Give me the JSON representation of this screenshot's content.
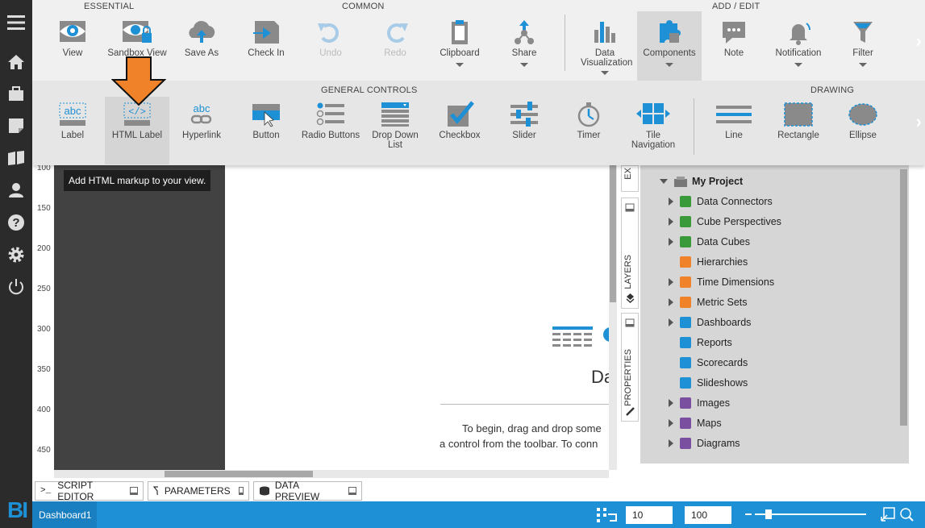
{
  "ribbon": {
    "groups": {
      "essential": "ESSENTIAL",
      "common": "COMMON",
      "add_edit": "ADD / EDIT",
      "general_controls": "GENERAL CONTROLS",
      "drawing": "DRAWING"
    },
    "buttons": {
      "view": "View",
      "sandbox_view": "Sandbox View",
      "save_as": "Save As",
      "check_in": "Check In",
      "undo": "Undo",
      "redo": "Redo",
      "clipboard": "Clipboard",
      "share": "Share",
      "data_visualization": "Data Visualization",
      "components": "Components",
      "note": "Note",
      "notification": "Notification",
      "filter": "Filter"
    },
    "controls": {
      "label": "Label",
      "html_label": "HTML Label",
      "hyperlink": "Hyperlink",
      "button": "Button",
      "radio_buttons": "Radio Buttons",
      "drop_down_list": "Drop Down List",
      "checkbox": "Checkbox",
      "slider": "Slider",
      "timer": "Timer",
      "tile_navigation": "Tile Navigation",
      "line": "Line",
      "rectangle": "Rectangle",
      "ellipse": "Ellipse"
    }
  },
  "tooltip": "Add HTML markup to your view.",
  "ruler": [
    "100",
    "150",
    "200",
    "250",
    "300",
    "350",
    "400",
    "450"
  ],
  "canvas": {
    "heading_partial": "Da",
    "hint_line1": "To begin, drag and drop some",
    "hint_line2": "a control from the toolbar. To conn"
  },
  "side_tabs": {
    "layers": "LAYERS",
    "properties": "PROPERTIES",
    "explorer": "EX"
  },
  "tree": {
    "root": "My Project",
    "items": [
      {
        "label": "Data Connectors",
        "expandable": true,
        "color": "#3a9a3a"
      },
      {
        "label": "Cube Perspectives",
        "expandable": true,
        "color": "#3a9a3a"
      },
      {
        "label": "Data Cubes",
        "expandable": true,
        "color": "#3a9a3a"
      },
      {
        "label": "Hierarchies",
        "expandable": false,
        "color": "#f0822a"
      },
      {
        "label": "Time Dimensions",
        "expandable": true,
        "color": "#f0822a"
      },
      {
        "label": "Metric Sets",
        "expandable": true,
        "color": "#f0822a"
      },
      {
        "label": "Dashboards",
        "expandable": true,
        "color": "#1e90d6"
      },
      {
        "label": "Reports",
        "expandable": false,
        "color": "#1e90d6"
      },
      {
        "label": "Scorecards",
        "expandable": false,
        "color": "#1e90d6"
      },
      {
        "label": "Slideshows",
        "expandable": false,
        "color": "#1e90d6"
      },
      {
        "label": "Images",
        "expandable": true,
        "color": "#7a4fa0"
      },
      {
        "label": "Maps",
        "expandable": true,
        "color": "#7a4fa0"
      },
      {
        "label": "Diagrams",
        "expandable": true,
        "color": "#7a4fa0"
      }
    ]
  },
  "bottom_tabs": {
    "script_editor": "SCRIPT EDITOR",
    "parameters": "PARAMETERS",
    "data_preview": "DATA PREVIEW"
  },
  "status": {
    "tab": "Dashboard1",
    "grid_size": "10",
    "zoom": "100",
    "zoom_slider_fraction": 0.1
  },
  "colors": {
    "accent": "#1e90d6",
    "arrow": "#f0822a",
    "nav_bg": "#2b2b2b"
  }
}
